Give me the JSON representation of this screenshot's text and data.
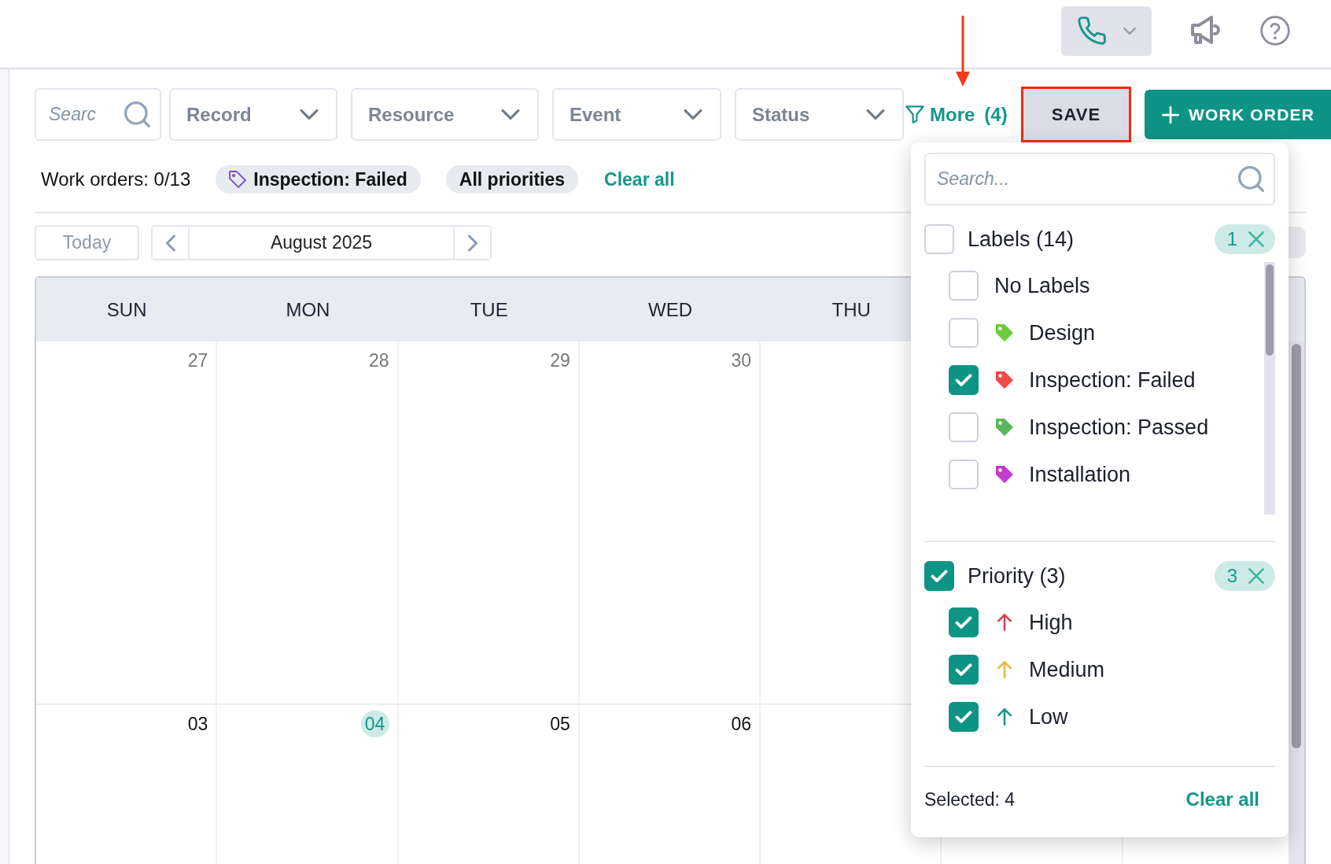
{
  "top_bar": {
    "actions": [
      {
        "kind": "phone"
      },
      {
        "kind": "megaphone"
      },
      {
        "kind": "help"
      }
    ]
  },
  "filters": {
    "search": {
      "placeholder": "Searc"
    },
    "dropdowns": [
      {
        "label": "Record"
      },
      {
        "label": "Resource"
      },
      {
        "label": "Event"
      },
      {
        "label": "Status"
      }
    ],
    "more": {
      "label": "More",
      "count": "(4)",
      "pointed_at": true
    },
    "save": {
      "label": "SAVE",
      "highlighted": true
    },
    "create": {
      "label": "WORK ORDER"
    }
  },
  "summary": {
    "count_text": "Work orders: 0/13",
    "chips": [
      {
        "label": "Inspection: Failed",
        "kind": "label"
      },
      {
        "label": "All priorities",
        "kind": "plain"
      }
    ],
    "clear": "Clear all"
  },
  "calendar": {
    "today_button": "Today",
    "month": "August 2025",
    "weekdays": [
      "SUN",
      "MON",
      "TUE",
      "WED",
      "THU"
    ],
    "weeks": [
      {
        "days": [
          {
            "date": "27",
            "outside_month": true,
            "today": false
          },
          {
            "date": "28",
            "outside_month": true,
            "today": false
          },
          {
            "date": "29",
            "outside_month": true,
            "today": false
          },
          {
            "date": "30",
            "outside_month": true,
            "today": false
          }
        ]
      },
      {
        "days": [
          {
            "date": "03",
            "outside_month": false,
            "today": false
          },
          {
            "date": "04",
            "outside_month": false,
            "today": true
          },
          {
            "date": "05",
            "outside_month": false,
            "today": false
          },
          {
            "date": "06",
            "outside_month": false,
            "today": false
          }
        ]
      }
    ]
  },
  "filter_panel": {
    "search": {
      "placeholder": "Search..."
    },
    "groups": [
      {
        "title": "Labels (14)",
        "checked": false,
        "badge": "1",
        "scrollable": true,
        "items": [
          {
            "label": "No Labels",
            "checked": false,
            "kind": "plain"
          },
          {
            "label": "Design",
            "checked": false,
            "kind": "tag",
            "color": "#6bcd3e"
          },
          {
            "label": "Inspection: Failed",
            "checked": true,
            "kind": "tag",
            "color": "#ee4a4a"
          },
          {
            "label": "Inspection: Passed",
            "checked": false,
            "kind": "tag",
            "color": "#5cb65c"
          },
          {
            "label": "Installation",
            "checked": false,
            "kind": "tag",
            "color": "#c43ccc"
          }
        ]
      },
      {
        "title": "Priority (3)",
        "checked": true,
        "badge": "3",
        "scrollable": false,
        "items": [
          {
            "label": "High",
            "checked": true,
            "kind": "arrow",
            "color": "#d9404f"
          },
          {
            "label": "Medium",
            "checked": true,
            "kind": "arrow",
            "color": "#f0b445"
          },
          {
            "label": "Low",
            "checked": true,
            "kind": "arrow",
            "color": "#14998a"
          }
        ]
      }
    ],
    "footer": {
      "selected": "Selected: 4",
      "clear": "Clear all"
    }
  }
}
